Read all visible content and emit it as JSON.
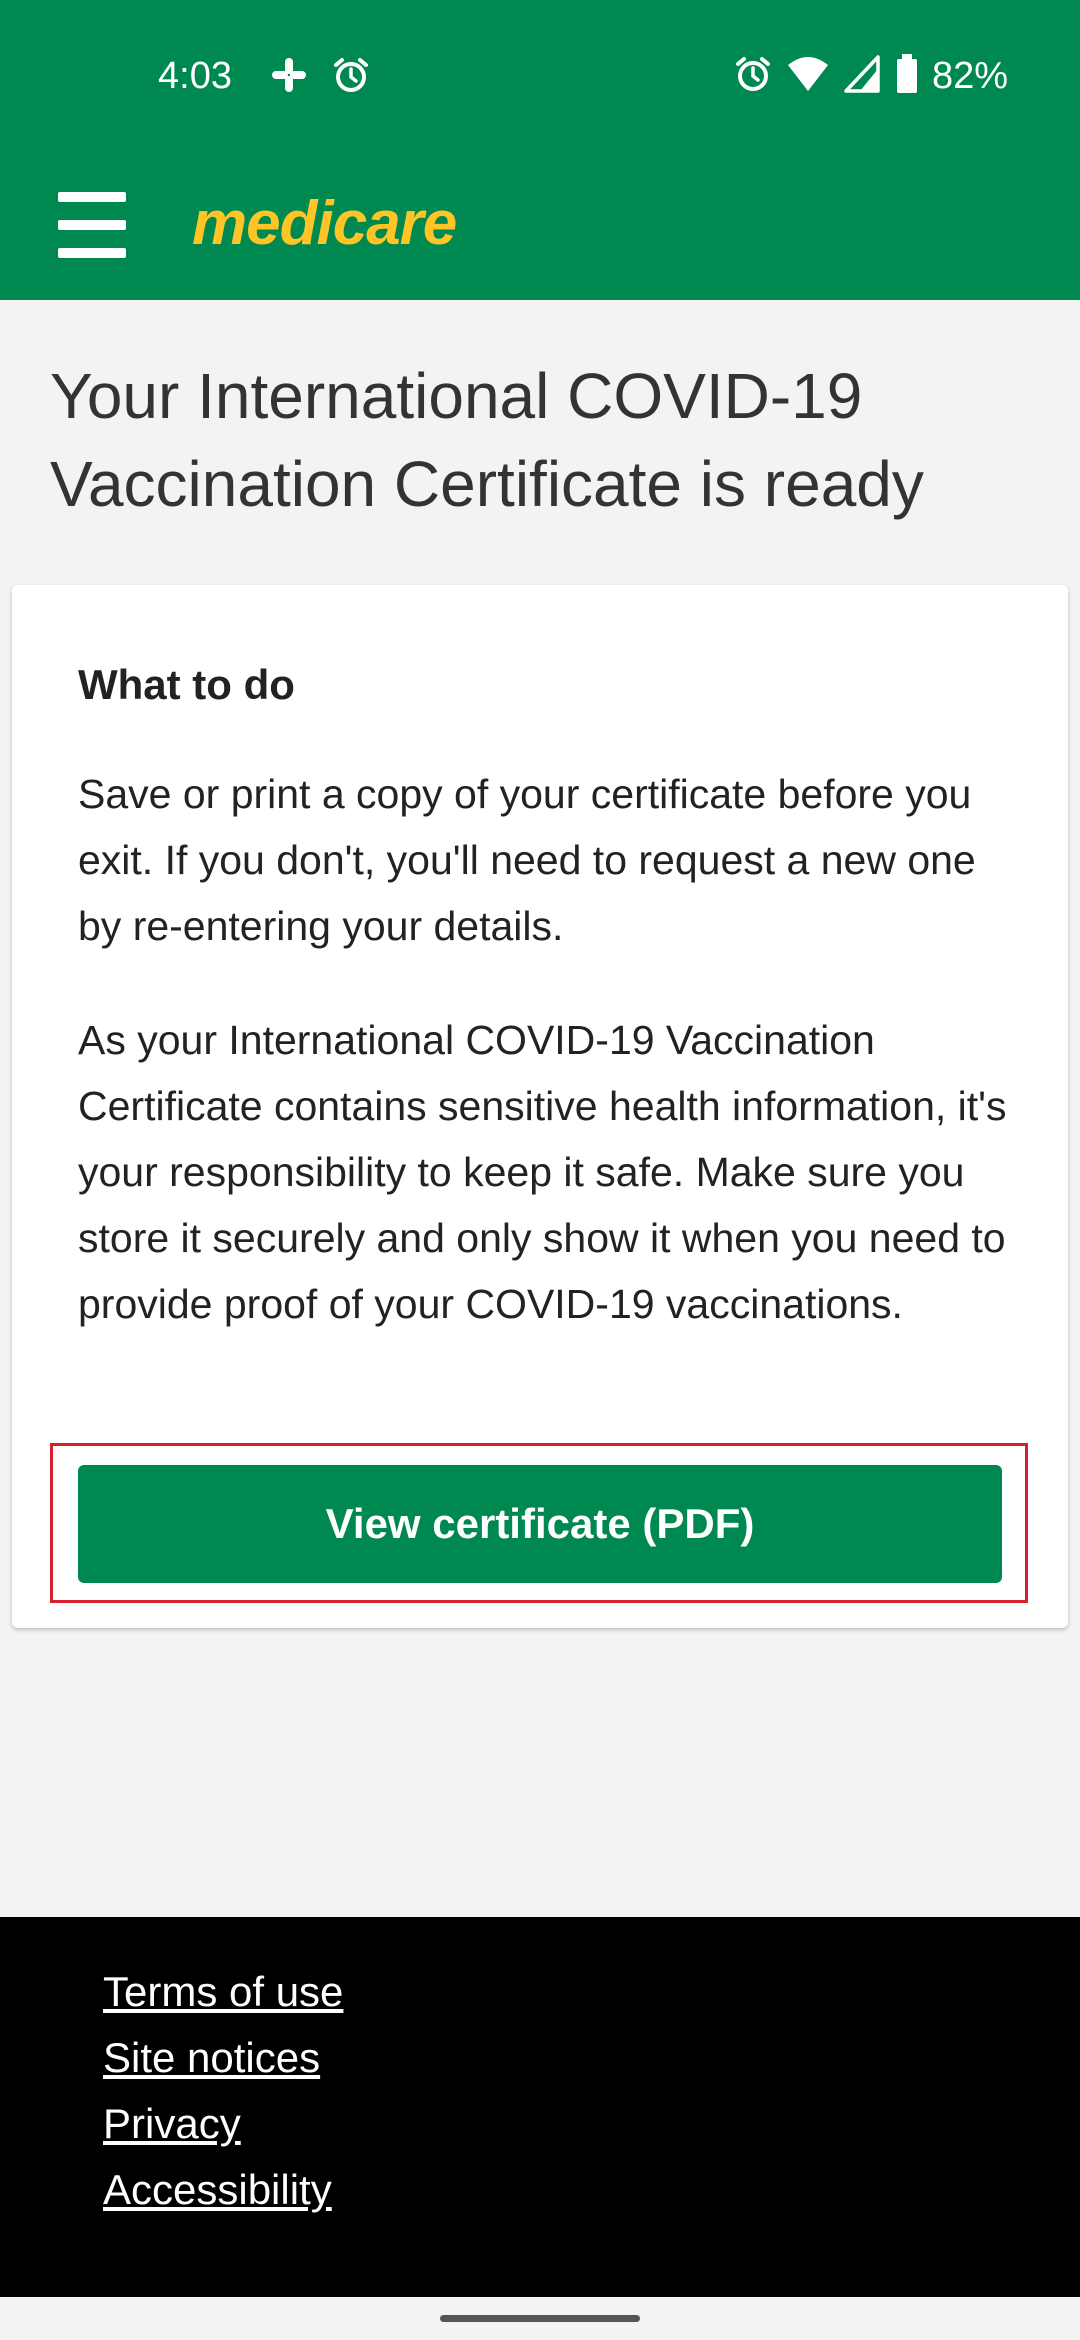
{
  "status_bar": {
    "time": "4:03",
    "battery_percent": "82%",
    "left_icons": [
      "slack-icon",
      "alarm-icon"
    ],
    "right_icons": [
      "alarm-icon",
      "wifi-icon",
      "cell-signal-icon",
      "battery-icon"
    ]
  },
  "header": {
    "logo_text": "medicare",
    "menu_icon": "hamburger-menu-icon"
  },
  "page": {
    "title": "Your International COVID-19 Vaccination Certificate is ready"
  },
  "card": {
    "heading": "What to do",
    "paragraph_1": "Save or print a copy of your certificate before you exit. If you don't, you'll need to request a new one by re-entering your details.",
    "paragraph_2": "As your International COVID-19 Vaccination Certificate contains sensitive health information, it's your responsibility to keep it safe. Make sure you store it securely and only show it when you need to provide proof of your COVID-19 vaccinations.",
    "button_label": "View certificate (PDF)"
  },
  "footer": {
    "links": [
      "Terms of use",
      "Site notices",
      "Privacy",
      "Accessibility"
    ]
  },
  "colors": {
    "brand_green": "#008851",
    "logo_yellow": "#ffc425",
    "focus_red": "#d6212f",
    "background": "#f2f4f3"
  }
}
